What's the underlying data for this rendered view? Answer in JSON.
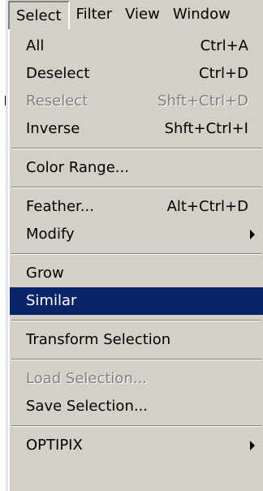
{
  "menubar": {
    "items": [
      "Select",
      "Filter",
      "View",
      "Window"
    ]
  },
  "menu": {
    "items": [
      {
        "label": "All",
        "shortcut": "Ctrl+A"
      },
      {
        "label": "Deselect",
        "shortcut": "Ctrl+D"
      },
      {
        "label": "Reselect",
        "shortcut": "Shft+Ctrl+D"
      },
      {
        "label": "Inverse",
        "shortcut": "Shft+Ctrl+I"
      },
      {
        "label": "Color Range..."
      },
      {
        "label": "Feather...",
        "shortcut": "Alt+Ctrl+D"
      },
      {
        "label": "Modify"
      },
      {
        "label": "Grow"
      },
      {
        "label": "Similar"
      },
      {
        "label": "Transform Selection"
      },
      {
        "label": "Load Selection..."
      },
      {
        "label": "Save Selection..."
      },
      {
        "label": "OPTIPIX"
      }
    ]
  },
  "colors": {
    "menu_background": "#d4d0c8",
    "highlight": "#0a246a",
    "disabled_text": "#808080"
  },
  "icons": {
    "submenu": "triangle-right-icon"
  }
}
